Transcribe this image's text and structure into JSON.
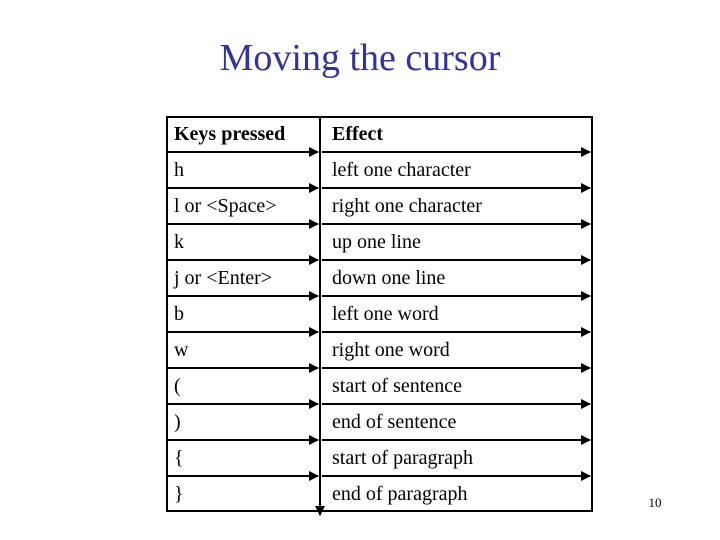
{
  "slide": {
    "title": "Moving the cursor",
    "title_color": "#333399",
    "background_color": "#ffffff",
    "page_number": "10"
  },
  "table": {
    "name": "cursor-movement-keys",
    "border_color": "#000000",
    "text_color": "#000000",
    "columns": [
      "Keys pressed",
      "Effect"
    ],
    "rows": [
      {
        "keys": "h",
        "effect": "left one character"
      },
      {
        "keys": "l or <Space>",
        "effect": "right one character"
      },
      {
        "keys": "k",
        "effect": "up one line"
      },
      {
        "keys": "j or <Enter>",
        "effect": "down one line"
      },
      {
        "keys": "b",
        "effect": "left one word"
      },
      {
        "keys": "w",
        "effect": "right one word"
      },
      {
        "keys": "(",
        "effect": "start of sentence"
      },
      {
        "keys": ")",
        "effect": "end of sentence"
      },
      {
        "keys": "{",
        "effect": "start of paragraph"
      },
      {
        "keys": "}",
        "effect": "end of paragraph"
      }
    ]
  },
  "rules": {
    "arrow_color": "#000000",
    "row_separator_count": 10,
    "column_divider": "vertical-down-arrow"
  }
}
